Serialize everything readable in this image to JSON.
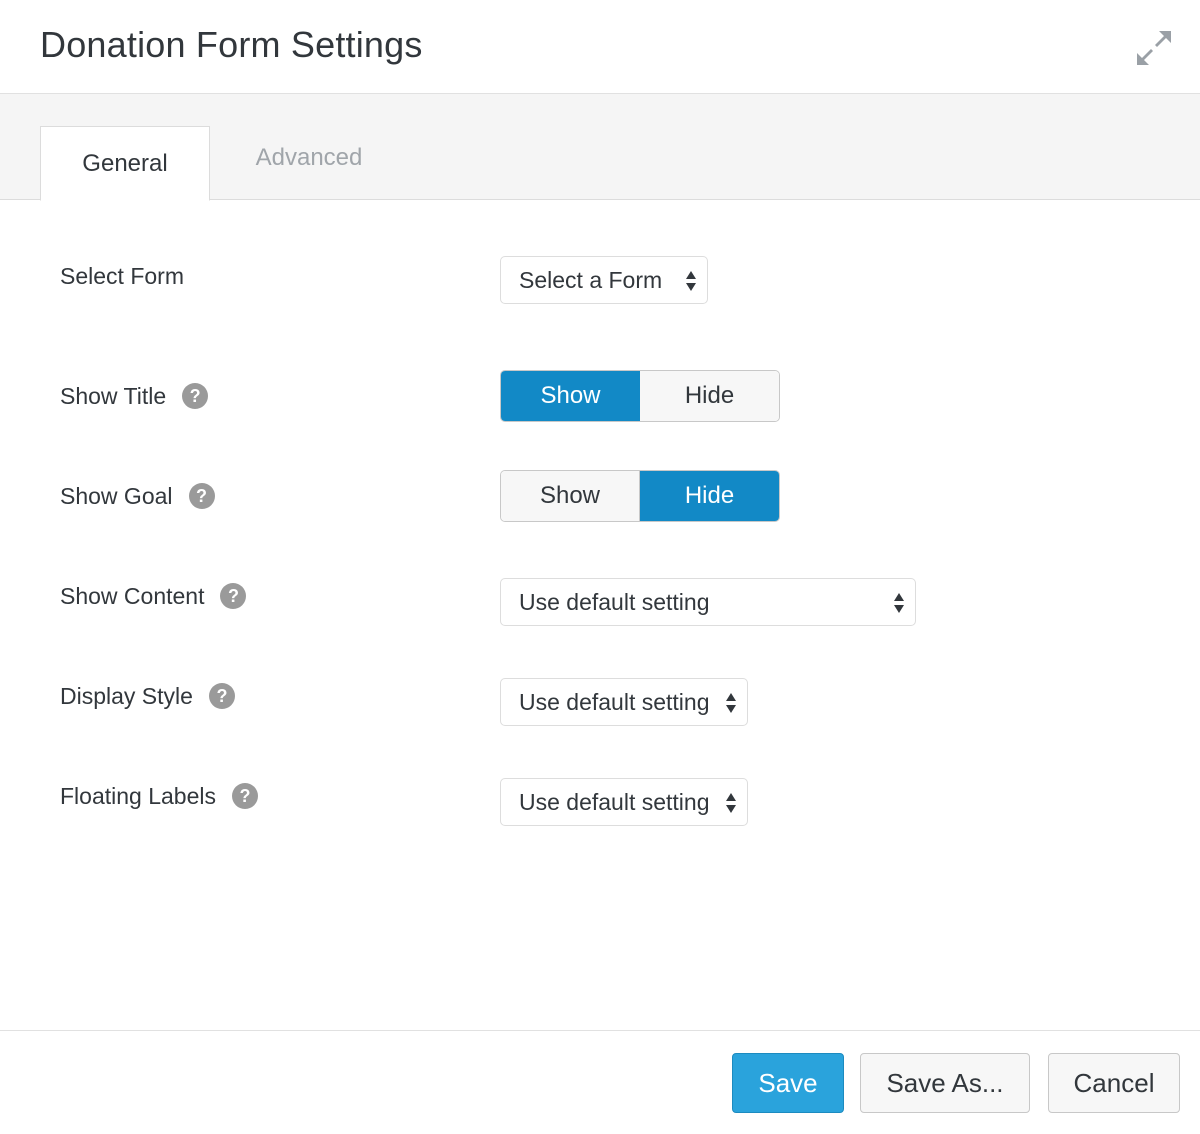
{
  "header": {
    "title": "Donation Form Settings",
    "expand_icon": "expand-arrows-icon"
  },
  "tabs": [
    {
      "label": "General",
      "active": true
    },
    {
      "label": "Advanced",
      "active": false
    }
  ],
  "fields": {
    "select_form": {
      "label": "Select Form",
      "value": "Select a Form"
    },
    "show_title": {
      "label": "Show Title",
      "help": "?",
      "options": [
        "Show",
        "Hide"
      ],
      "selected": "Show"
    },
    "show_goal": {
      "label": "Show Goal",
      "help": "?",
      "options": [
        "Show",
        "Hide"
      ],
      "selected": "Hide"
    },
    "show_content": {
      "label": "Show Content",
      "help": "?",
      "value": "Use default setting"
    },
    "display_style": {
      "label": "Display Style",
      "help": "?",
      "value": "Use default setting"
    },
    "floating_labels": {
      "label": "Floating Labels",
      "help": "?",
      "value": "Use default setting"
    }
  },
  "footer": {
    "save": "Save",
    "save_as": "Save As...",
    "cancel": "Cancel"
  },
  "colors": {
    "accent": "#1289c6",
    "save_button": "#2aa3dc",
    "help_icon": "#9a9a9a"
  }
}
